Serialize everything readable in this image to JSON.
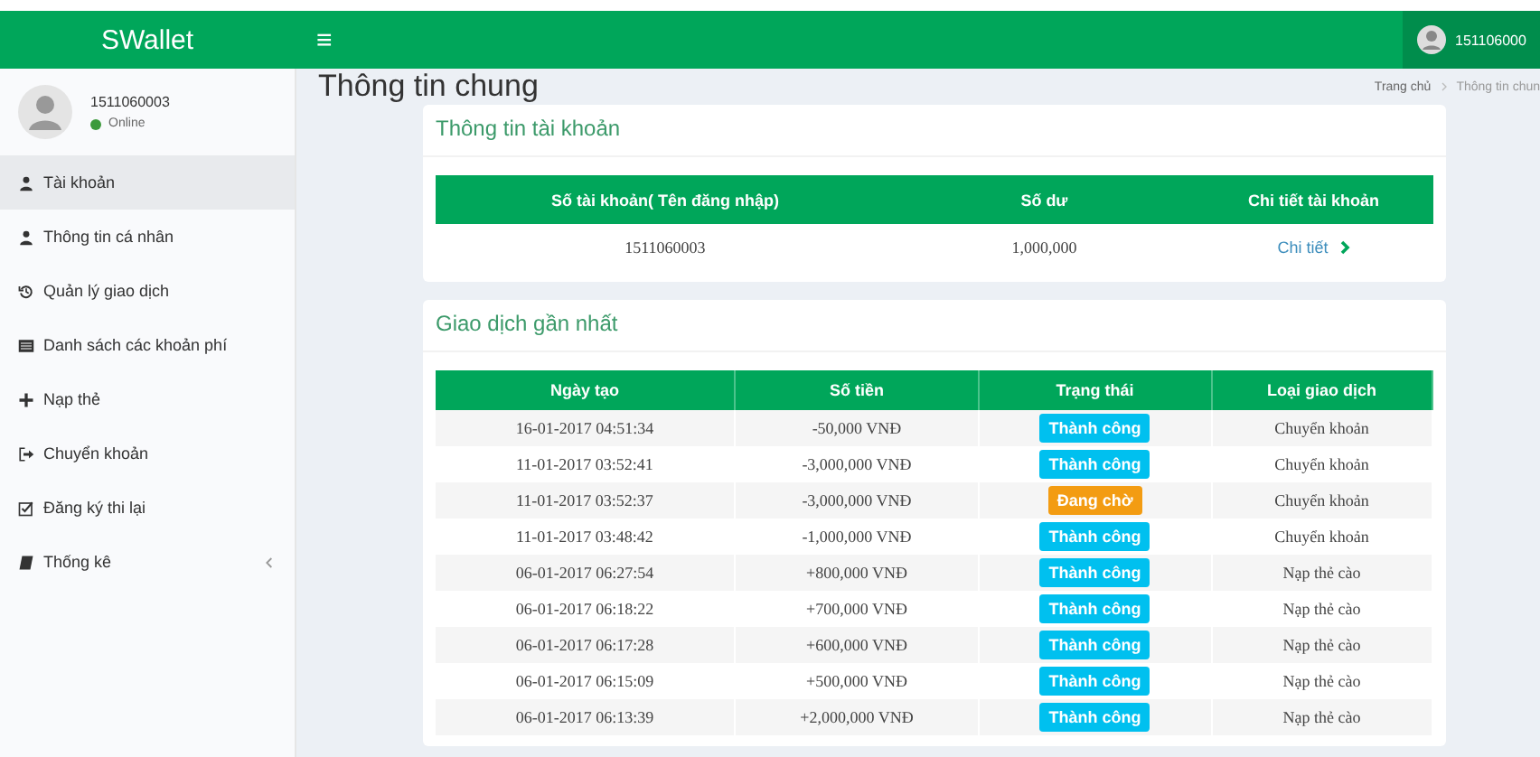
{
  "header": {
    "logo": "SWallet",
    "menu_toggle": "≡",
    "user_name": "151106000"
  },
  "sidebar": {
    "user": {
      "name": "1511060003",
      "status": "Online",
      "online": true
    },
    "items": [
      {
        "label": "Tài khoản",
        "selected": true,
        "has_submenu": false
      },
      {
        "label": "Thông tin cá nhân",
        "selected": false,
        "has_submenu": false
      },
      {
        "label": "Quản lý giao dịch",
        "selected": false,
        "has_submenu": false
      },
      {
        "label": "Danh sách các khoản phí",
        "selected": false,
        "has_submenu": false
      },
      {
        "label": "Nạp thẻ",
        "selected": false,
        "has_submenu": false
      },
      {
        "label": "Chuyển khoản",
        "selected": false,
        "has_submenu": false
      },
      {
        "label": "Đăng ký thi lại",
        "selected": false,
        "has_submenu": false
      },
      {
        "label": "Thống kê",
        "selected": false,
        "has_submenu": true
      }
    ]
  },
  "page_title": "Thông tin chung",
  "breadcrumb": [
    "Trang chủ",
    "Thông tin chun"
  ],
  "account": {
    "title": "Thông tin tài khoản",
    "columns": [
      "Số tài khoản( Tên đăng nhập)",
      "Số dư",
      "Chi tiết tài khoản"
    ],
    "rows": [
      {
        "account": "1511060003",
        "balance": "1,000,000",
        "link": "Chi tiết"
      }
    ]
  },
  "transactions": {
    "title": "Giao dịch gần nhất",
    "columns": [
      "Ngày tạo",
      "Số tiền",
      "Trạng thái",
      "Loại giao dịch"
    ],
    "rows": [
      {
        "date": "16-01-2017 04:51:34",
        "amount": "-50,000 VNĐ",
        "status": {
          "label": "Thành công",
          "kind": "success"
        },
        "type": "Chuyển khoản"
      },
      {
        "date": "11-01-2017 03:52:41",
        "amount": "-3,000,000 VNĐ",
        "status": {
          "label": "Thành công",
          "kind": "success"
        },
        "type": "Chuyển khoản"
      },
      {
        "date": "11-01-2017 03:52:37",
        "amount": "-3,000,000 VNĐ",
        "status": {
          "label": "Đang chờ",
          "kind": "pending"
        },
        "type": "Chuyển khoản"
      },
      {
        "date": "11-01-2017 03:48:42",
        "amount": "-1,000,000 VNĐ",
        "status": {
          "label": "Thành công",
          "kind": "success"
        },
        "type": "Chuyển khoản"
      },
      {
        "date": "06-01-2017 06:27:54",
        "amount": "+800,000 VNĐ",
        "status": {
          "label": "Thành công",
          "kind": "success"
        },
        "type": "Nạp thẻ cào"
      },
      {
        "date": "06-01-2017 06:18:22",
        "amount": "+700,000 VNĐ",
        "status": {
          "label": "Thành công",
          "kind": "success"
        },
        "type": "Nạp thẻ cào"
      },
      {
        "date": "06-01-2017 06:17:28",
        "amount": "+600,000 VNĐ",
        "status": {
          "label": "Thành công",
          "kind": "success"
        },
        "type": "Nạp thẻ cào"
      },
      {
        "date": "06-01-2017 06:15:09",
        "amount": "+500,000 VNĐ",
        "status": {
          "label": "Thành công",
          "kind": "success"
        },
        "type": "Nạp thẻ cào"
      },
      {
        "date": "06-01-2017 06:13:39",
        "amount": "+2,000,000 VNĐ",
        "status": {
          "label": "Thành công",
          "kind": "success"
        },
        "type": "Nạp thẻ cào"
      }
    ]
  }
}
